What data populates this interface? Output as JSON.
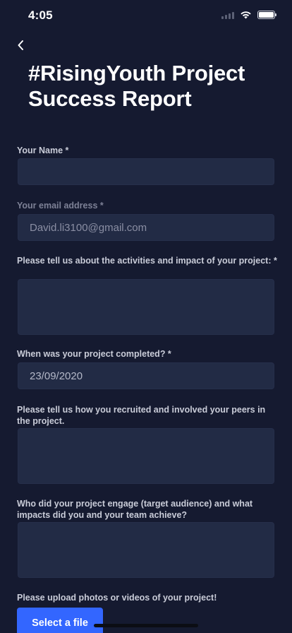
{
  "status": {
    "time": "4:05"
  },
  "header": {
    "title": "#RisingYouth Project Success Report"
  },
  "form": {
    "name": {
      "label": "Your Name *",
      "value": ""
    },
    "email": {
      "label": "Your email address *",
      "value": "David.li3100@gmail.com"
    },
    "activities": {
      "label": "Please tell us about the activities and impact of your project: *",
      "value": ""
    },
    "completed": {
      "label": "When was your project completed? *",
      "value": "23/09/2020"
    },
    "recruitment": {
      "label": "Please tell us how you recruited and involved your peers in the project.",
      "value": ""
    },
    "engagement": {
      "label": "Who did your project engage (target audience) and what impacts did you and your team achieve?",
      "value": ""
    },
    "upload": {
      "label": "Please upload photos or videos of your project!",
      "button_label": "Select a file"
    }
  },
  "colors": {
    "background": "#151a30",
    "field": "#222b45",
    "accent": "#3366ff"
  },
  "icons": {
    "back": "chevron-left-icon",
    "wifi": "wifi-icon",
    "battery": "battery-icon",
    "signal": "cellular-signal-icon"
  }
}
